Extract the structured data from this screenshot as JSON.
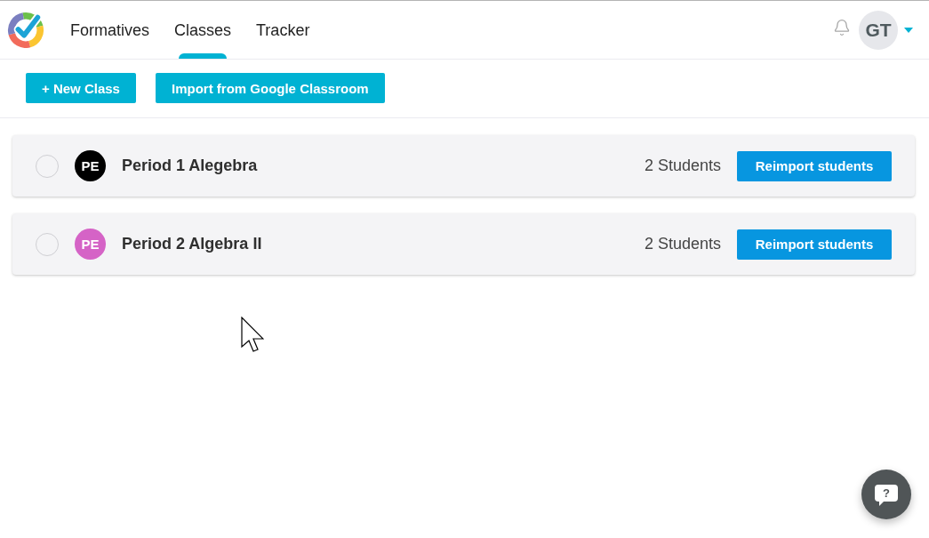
{
  "nav": {
    "items": [
      {
        "label": "Formatives",
        "selected": false
      },
      {
        "label": "Classes",
        "selected": true
      },
      {
        "label": "Tracker",
        "selected": false
      }
    ]
  },
  "account": {
    "initials": "GT"
  },
  "toolbar": {
    "buttons": [
      "+ New Class",
      "Import from Google Classroom"
    ]
  },
  "classes": [
    {
      "checked": false,
      "initials": "PE",
      "color": "#000000",
      "name": "Period 1 Alegebra",
      "students": "2 Students",
      "action": "Reimport students"
    },
    {
      "checked": false,
      "initials": "PE",
      "color": "#d563c6",
      "name": "Period 2 Algebra II",
      "students": "2 Students",
      "action": "Reimport students"
    }
  ],
  "help_button": {
    "label": "?"
  }
}
